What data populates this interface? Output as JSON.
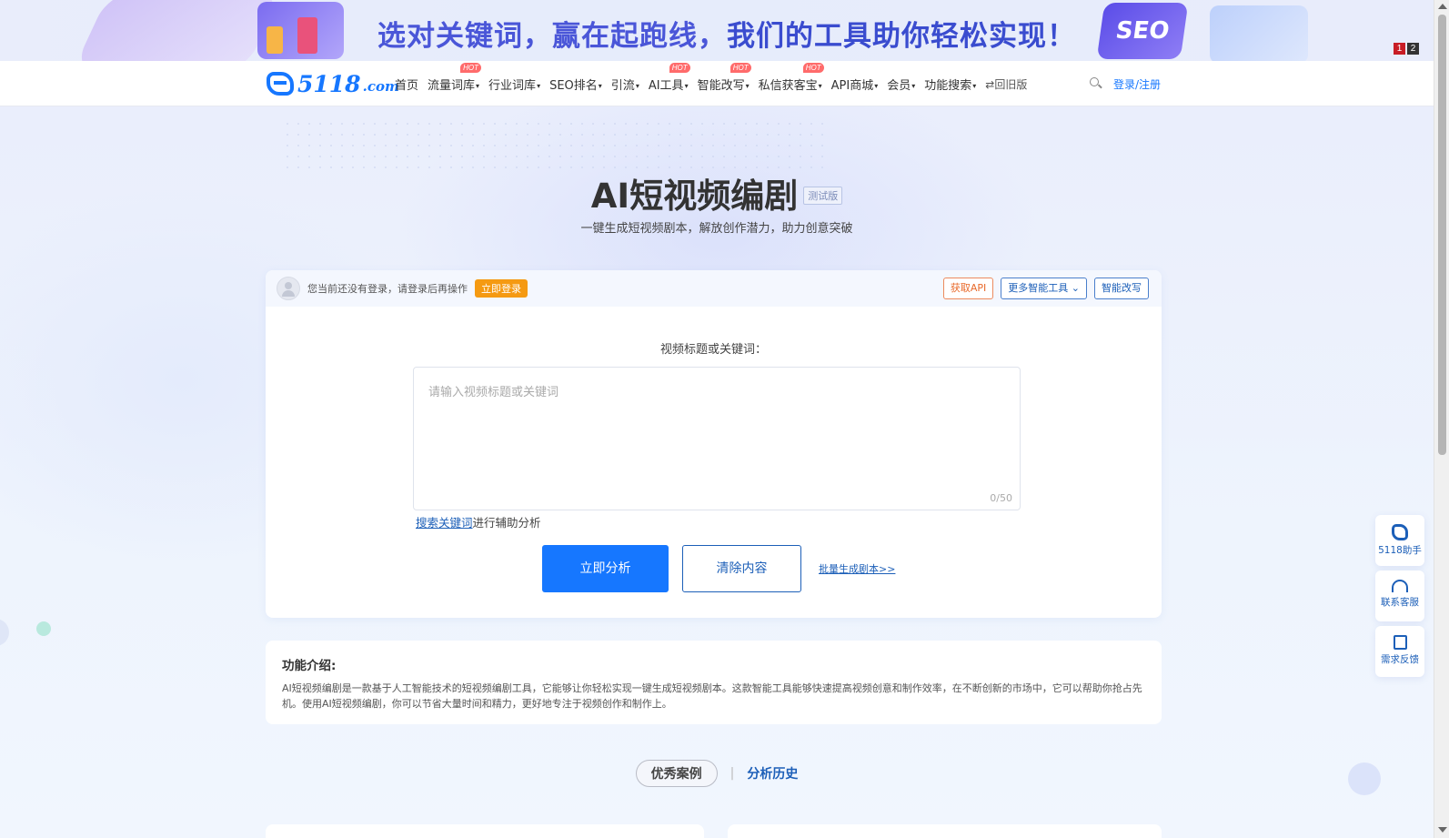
{
  "banner": {
    "text_part1": "选对关键词，赢在起跑线，",
    "text_part2": "我们的工具助你轻松实现！",
    "badge": "SEO",
    "pager": [
      "1",
      "2"
    ]
  },
  "nav": {
    "logo_main": "5118",
    "logo_suffix": ".com",
    "hot_label": "HOT",
    "items": [
      {
        "label": "首页",
        "dropdown": false,
        "hot": false
      },
      {
        "label": "流量词库",
        "dropdown": true,
        "hot": true
      },
      {
        "label": "行业词库",
        "dropdown": true,
        "hot": false
      },
      {
        "label": "SEO排名",
        "dropdown": true,
        "hot": false
      },
      {
        "label": "引流",
        "dropdown": true,
        "hot": false
      },
      {
        "label": "AI工具",
        "dropdown": true,
        "hot": true
      },
      {
        "label": "智能改写",
        "dropdown": true,
        "hot": true
      },
      {
        "label": "私信获客宝",
        "dropdown": true,
        "hot": true
      },
      {
        "label": "API商城",
        "dropdown": true,
        "hot": false
      },
      {
        "label": "会员",
        "dropdown": true,
        "hot": false
      },
      {
        "label": "功能搜索",
        "dropdown": true,
        "hot": false
      }
    ],
    "old_version": "⇄回旧版",
    "login": "登录/注册"
  },
  "hero": {
    "title": "AI短视频编剧",
    "beta": "测试版",
    "subtitle": "一键生成短视频剧本，解放创作潜力，助力创意突破"
  },
  "card": {
    "login_tip": "您当前还没有登录，请登录后再操作",
    "login_button": "立即登录",
    "get_api": "获取API",
    "more_tools": "更多智能工具",
    "smart_rewrite": "智能改写",
    "field_label": "视频标题或关键词：",
    "input_placeholder": "请输入视频标题或关键词",
    "input_value": "",
    "counter": "0/50",
    "assist_link": "搜索关键词",
    "assist_text": "进行辅助分析",
    "analyze_button": "立即分析",
    "clear_button": "清除内容",
    "batch_link": "批量生成剧本>>"
  },
  "intro": {
    "title": "功能介绍:",
    "body": "AI短视频编剧是一款基于人工智能技术的短视频编剧工具，它能够让你轻松实现一键生成短视频剧本。这款智能工具能够快速提高视频创意和制作效率，在不断创新的市场中，它可以帮助你抢占先机。使用AI短视频编剧，你可以节省大量时间和精力，更好地专注于视频创作和制作上。"
  },
  "tabs": {
    "active": "优秀案例",
    "separator": "|",
    "other": "分析历史"
  },
  "side_tools": [
    {
      "label": "5118助手",
      "icon": "5118-icon"
    },
    {
      "label": "联系客服",
      "icon": "headset-icon"
    },
    {
      "label": "需求反馈",
      "icon": "feedback-icon"
    }
  ],
  "colors": {
    "primary": "#1677ff",
    "link": "#1c5fb8",
    "login_orange": "#f59a12",
    "api_orange": "#e8692a",
    "hot_red": "#ff6b6b"
  }
}
